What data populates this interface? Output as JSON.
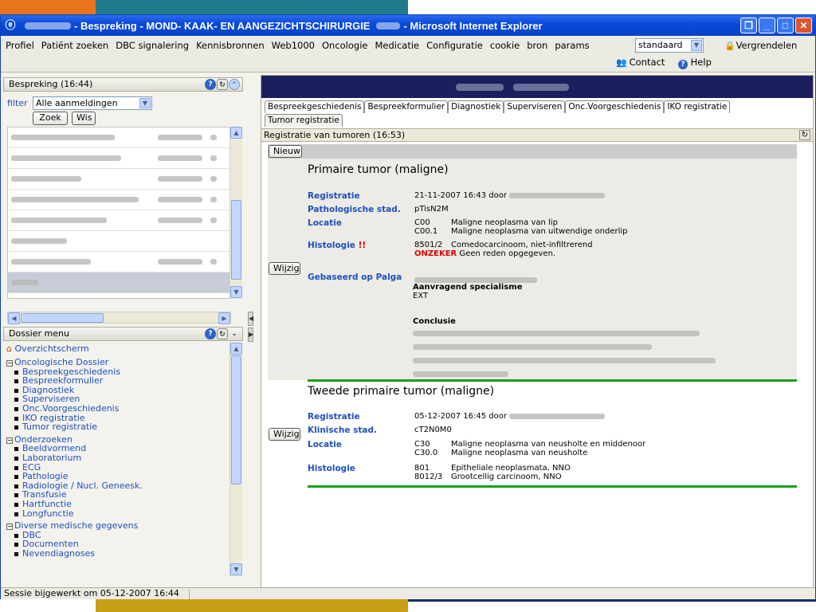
{
  "window": {
    "title_prefix": "- Bespreking - MOND- KAAK- EN AANGEZICHTSCHIRURGIE",
    "title_suffix": "- Microsoft Internet Explorer"
  },
  "menu": {
    "items": [
      "Profiel",
      "Patiënt zoeken",
      "DBC signalering",
      "Kennisbronnen",
      "Web1000",
      "Oncologie",
      "Medicatie",
      "Configuratie",
      "cookie",
      "bron",
      "params"
    ],
    "select_value": "standaard",
    "lock_label": "Vergrendelen",
    "contact_label": "Contact",
    "help_label": "Help"
  },
  "bespreking_panel": {
    "title": "Bespreking (16:44)",
    "filter_label": "filter",
    "filter_value": "Alle aanmeldingen",
    "search_button": "Zoek",
    "clear_button": "Wis"
  },
  "dossier_panel": {
    "title": "Dossier menu",
    "overview": "Overzichtscherm",
    "sections": [
      {
        "label": "Oncologische Dossier",
        "items": [
          "Bespreekgeschiedenis",
          "Bespreekformulier",
          "Diagnostiek",
          "Superviseren",
          "Onc.Voorgeschiedenis",
          "IKO registratie",
          "Tumor registratie"
        ]
      },
      {
        "label": "Onderzoeken",
        "items": [
          "Beeldvormend",
          "Laboratorium",
          "ECG",
          "Pathologie",
          "Radiologie / Nucl. Geneesk.",
          "Transfusie",
          "Hartfunctie",
          "Longfunctie"
        ]
      },
      {
        "label": "Diverse medische gegevens",
        "items": [
          "DBC",
          "Documenten",
          "Nevendiagnoses"
        ]
      }
    ]
  },
  "tabs": {
    "row1": [
      "Bespreekgeschiedenis",
      "Bespreekformulier",
      "Diagnostiek",
      "Superviseren",
      "Onc.Voorgeschiedenis",
      "IKO registratie"
    ],
    "row2": [
      "Tumor registratie"
    ]
  },
  "registratie": {
    "section_title": "Registratie van tumoren (16:53)",
    "new_button": "Nieuw",
    "edit_button": "Wijzig",
    "tumor1": {
      "title": "Primaire tumor (maligne)",
      "reg_label": "Registratie",
      "reg_value": "21-11-2007 16:43 door",
      "stad_label": "Pathologische stad.",
      "stad_value": "pTisN2M",
      "loc_label": "Locatie",
      "loc_code1": "C00",
      "loc_text1": "Maligne neoplasma van lip",
      "loc_code2": "C00.1",
      "loc_text2": "Maligne neoplasma van uitwendige onderlip",
      "hist_label": "Histologie",
      "hist_flag": "!!",
      "hist_code": "8501/2",
      "hist_text": "Comedocarcinoom, niet-infiltrerend",
      "uncertain": "ONZEKER",
      "uncertain_text": "Geen reden opgegeven.",
      "palga_label": "Gebaseerd op Palga",
      "spec_label": "Aanvragend specialisme",
      "spec_value": "EXT",
      "concl_label": "Conclusie"
    },
    "tumor2": {
      "title": "Tweede primaire tumor (maligne)",
      "reg_label": "Registratie",
      "reg_value": "05-12-2007 16:45 door",
      "stad_label": "Klinische stad.",
      "stad_value": "cT2N0M0",
      "loc_label": "Locatie",
      "loc_code1": "C30",
      "loc_text1": "Maligne neoplasma van neusholte en middenoor",
      "loc_code2": "C30.0",
      "loc_text2": "Maligne neoplasma van neusholte",
      "hist_label": "Histologie",
      "hist_code1": "801",
      "hist_text1": "Epitheliale neoplasmata, NNO",
      "hist_code2": "8012/3",
      "hist_text2": "Grootcellig carcinoom, NNO"
    }
  },
  "status": {
    "text": "Sessie bijgewerkt om 05-12-2007 16:44"
  }
}
